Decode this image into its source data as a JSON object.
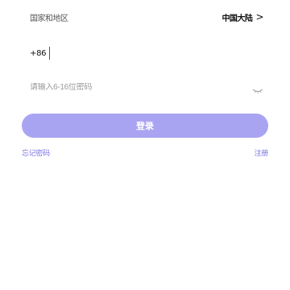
{
  "region": {
    "label": "国家和地区",
    "value": "中国大陆",
    "chevron": ">"
  },
  "phone": {
    "prefix": "+86",
    "value": "",
    "placeholder": ""
  },
  "password": {
    "placeholder": "请输入6-16位密码",
    "value": ""
  },
  "actions": {
    "login_label": "登录",
    "forgot_label": "忘记密码",
    "register_label": "注册"
  },
  "colors": {
    "accent": "#a9a4f2",
    "link": "#7a73e6"
  },
  "icons": {
    "region_chevron": "chevron-right-icon",
    "password_toggle": "eye-closed-icon"
  }
}
